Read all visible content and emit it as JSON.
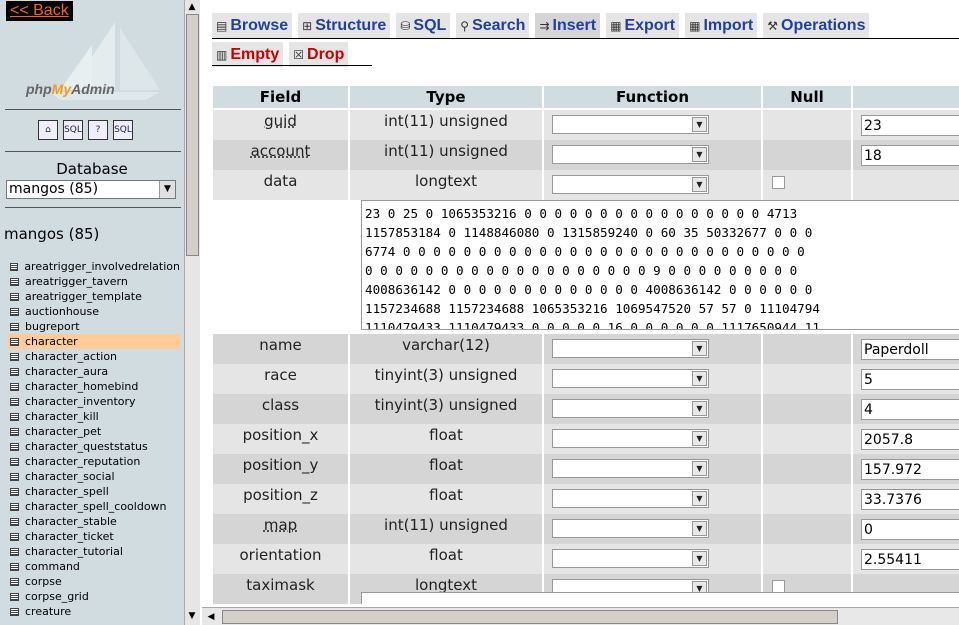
{
  "sidebar": {
    "back_label": "<< Back",
    "logo": {
      "prefix": "php",
      "my": "My",
      "suffix": "Admin"
    },
    "icons": [
      "home-icon",
      "sql-icon",
      "help-icon",
      "sql-doc-icon"
    ],
    "icon_glyphs": [
      "⌂",
      "SQL",
      "?",
      "SQL"
    ],
    "database_label": "Database",
    "database_select": "mangos (85)",
    "db_heading": "mangos (85)",
    "tables": [
      "areatrigger_involvedrelation",
      "areatrigger_tavern",
      "areatrigger_template",
      "auctionhouse",
      "bugreport",
      "character",
      "character_action",
      "character_aura",
      "character_homebind",
      "character_inventory",
      "character_kill",
      "character_pet",
      "character_queststatus",
      "character_reputation",
      "character_social",
      "character_spell",
      "character_spell_cooldown",
      "character_stable",
      "character_ticket",
      "character_tutorial",
      "command",
      "corpse",
      "corpse_grid",
      "creature"
    ],
    "selected_table": "character"
  },
  "tabs_row1": [
    {
      "label": "Browse",
      "icon": "▤"
    },
    {
      "label": "Structure",
      "icon": "⊞"
    },
    {
      "label": "SQL",
      "icon": "⛁"
    },
    {
      "label": "Search",
      "icon": "⚲"
    },
    {
      "label": "Insert",
      "icon": "⇉",
      "active": true
    },
    {
      "label": "Export",
      "icon": "▦"
    },
    {
      "label": "Import",
      "icon": "▦"
    },
    {
      "label": "Operations",
      "icon": "⚒"
    }
  ],
  "tabs_row2": [
    {
      "label": "Empty",
      "icon": "▥"
    },
    {
      "label": "Drop",
      "icon": "☒"
    }
  ],
  "table_headers": {
    "field": "Field",
    "type": "Type",
    "function": "Function",
    "null": "Null",
    "value": ""
  },
  "rows": [
    {
      "field": "guid",
      "type": "int(11) unsigned",
      "value": "23",
      "underline": true
    },
    {
      "field": "account",
      "type": "int(11) unsigned",
      "value": "18",
      "underline": true
    },
    {
      "field": "data",
      "type": "longtext",
      "nullbox": true
    },
    {
      "field": "name",
      "type": "varchar(12)",
      "value": "Paperdoll"
    },
    {
      "field": "race",
      "type": "tinyint(3) unsigned",
      "value": "5"
    },
    {
      "field": "class",
      "type": "tinyint(3) unsigned",
      "value": "4"
    },
    {
      "field": "position_x",
      "type": "float",
      "value": "2057.8"
    },
    {
      "field": "position_y",
      "type": "float",
      "value": "157.972"
    },
    {
      "field": "position_z",
      "type": "float",
      "value": "33.7376"
    },
    {
      "field": "map",
      "type": "int(11) unsigned",
      "value": "0",
      "underline": true
    },
    {
      "field": "orientation",
      "type": "float",
      "value": "2.55411"
    },
    {
      "field": "taximask",
      "type": "longtext",
      "nullbox": true
    }
  ],
  "data_text": "23 0 25 0 1065353216 0 0 0 0 0 0 0 0 0 0 0 0 0 0 0 0 4713\n1157853184 0 1148846080 0 1315859240 0 60 35 50332677 0 0 0\n6774 0 0 0 0 0 0 0 0 0 0 0 0 0 0 0 0 0 0 0 0 0 0 0 0 0 0 0\n0 0 0 0 0 0 0 0 0 0 0 0 0 0 0 0 0 0 0 9 0 0 0 0 0 0 0 0 0\n4008636142 0 0 0 0 0 0 0 0 0 0 0 0 0 4008636142 0 0 0 0 0 0\n1157234688 1157234688 1065353216 1069547520 57 57 0 11104794\n1110479433 1110479433 0 0 0 0 0 16 0 0 0 0 0 0 1117650944 11"
}
